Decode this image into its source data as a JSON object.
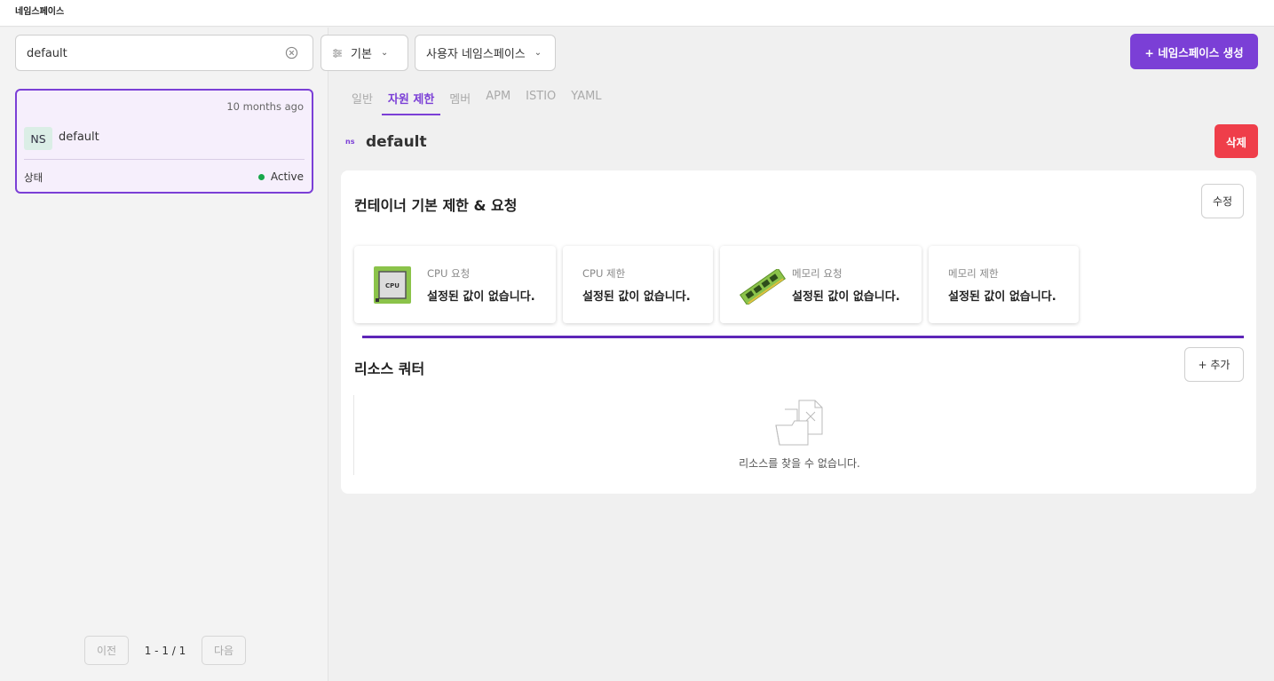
{
  "header": {
    "title": "네임스페이스"
  },
  "toolbar": {
    "search_value": "default",
    "filter_label": "기본",
    "ns_type_label": "사용자 네임스페이스",
    "create_label": "+ 네임스페이스 생성"
  },
  "list": {
    "items": [
      {
        "time": "10 months ago",
        "avatar": "NS",
        "name": "default",
        "status_label": "상태",
        "status": "Active"
      }
    ],
    "pager": {
      "prev": "이전",
      "info": "1 - 1 / 1",
      "next": "다음"
    }
  },
  "detail": {
    "tabs": [
      "일반",
      "자원 제한",
      "멤버",
      "APM",
      "ISTIO",
      "YAML"
    ],
    "active_tab": "자원 제한",
    "badge": "ns",
    "name": "default",
    "delete_label": "삭제",
    "limits": {
      "title": "컨테이너 기본 제한 & 요청",
      "edit_label": "수정",
      "metrics": [
        {
          "label": "CPU 요청",
          "value": "설정된 값이 없습니다.",
          "icon": "cpu-icon"
        },
        {
          "label": "CPU 제한",
          "value": "설정된 값이 없습니다."
        },
        {
          "label": "메모리 요청",
          "value": "설정된 값이 없습니다.",
          "icon": "memory-icon"
        },
        {
          "label": "메모리 제한",
          "value": "설정된 값이 없습니다."
        }
      ],
      "cpu_chip_text": "CPU"
    },
    "quota": {
      "title": "리소스 쿼터",
      "add_label": "+ 추가",
      "empty_text": "리소스를 찾을 수 없습니다."
    }
  },
  "colors": {
    "accent": "#7b3fd6",
    "danger": "#ef3e4a",
    "status_active": "#17a74a",
    "divider": "#5e25b8"
  }
}
